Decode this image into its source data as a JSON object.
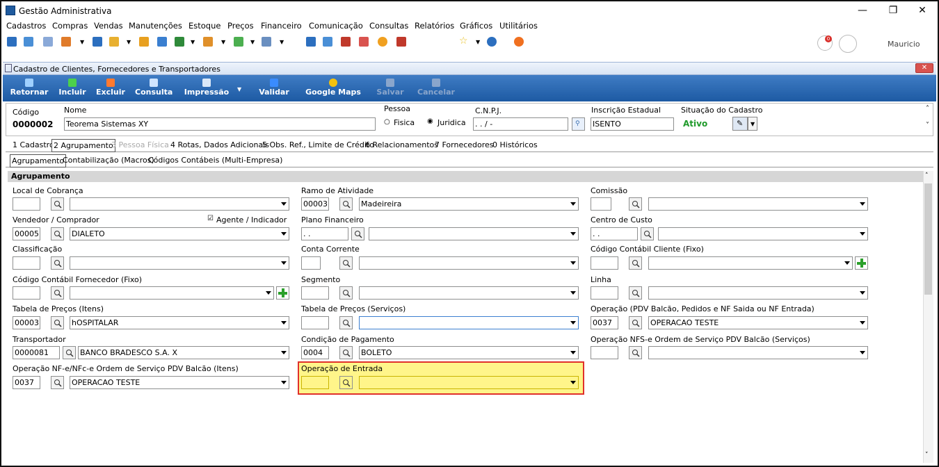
{
  "window": {
    "title": "Gestão Administrativa",
    "min": "—",
    "max": "❐",
    "close": "✕"
  },
  "menu": [
    "Cadastros",
    "Compras",
    "Vendas",
    "Manutenções",
    "Estoque",
    "Preços",
    "Financeiro",
    "Comunicação",
    "Consultas",
    "Relatórios",
    "Gráficos",
    "Utilitários"
  ],
  "user": {
    "name": "Mauricio",
    "notification_count": "0"
  },
  "child": {
    "title": "Cadastro de Clientes, Fornecedores e Transportadores",
    "close": "✕"
  },
  "actions": {
    "retornar": "Retornar",
    "incluir": "Incluir",
    "excluir": "Excluir",
    "consulta": "Consulta",
    "impressao": "Impressão",
    "validar": "Validar",
    "google_maps": "Google Maps",
    "salvar": "Salvar",
    "cancelar": "Cancelar"
  },
  "header": {
    "codigo_label": "Código",
    "codigo": "0000002",
    "nome_label": "Nome",
    "nome": "Teorema Sistemas XY",
    "pessoa_label": "Pessoa",
    "fisica": "Fisica",
    "juridica": "Juridica",
    "cnpj_label": "C.N.P.J.",
    "cnpj": "  .  .  /    -",
    "ie_label": "Inscrição Estadual",
    "ie": "ISENTO",
    "situacao_label": "Situação do Cadastro",
    "situacao": "Ativo"
  },
  "tabs": [
    "1 Cadastro",
    "2 Agrupamento",
    "3 Pessoa Física",
    "4 Rotas, Dados Adicionais",
    "5 Obs. Ref., Limite de Crédito",
    "6 Relacionamentos",
    "7 Fornecedores",
    "0 Históricos"
  ],
  "subtabs": [
    "Agrupamento",
    "Contabilização (Macros)",
    "Códigos Contábeis (Multi-Empresa)"
  ],
  "section": "Agrupamento",
  "fields": {
    "local_cobranca": {
      "label": "Local de Cobrança",
      "code": "",
      "value": ""
    },
    "ramo_atividade": {
      "label": "Ramo de Atividade",
      "code": "00003",
      "value": "Madeireira"
    },
    "comissao": {
      "label": "Comissão",
      "code": "",
      "value": ""
    },
    "vendedor": {
      "label": "Vendedor / Comprador",
      "code": "00005",
      "value": "DIALETO",
      "agente": "Agente / Indicador"
    },
    "plano_financeiro": {
      "label": "Plano Financeiro",
      "code": " .  .",
      "value": ""
    },
    "centro_custo": {
      "label": "Centro de Custo",
      "code": " .  .",
      "value": ""
    },
    "classificacao": {
      "label": "Classificação",
      "code": "",
      "value": ""
    },
    "conta_corrente": {
      "label": "Conta Corrente",
      "code": "",
      "value": ""
    },
    "cod_contabil_cliente": {
      "label": "Código Contábil Cliente (Fixo)",
      "code": "",
      "value": ""
    },
    "cod_contabil_fornecedor": {
      "label": "Código Contábil Fornecedor (Fixo)",
      "code": "",
      "value": ""
    },
    "segmento": {
      "label": "Segmento",
      "code": "",
      "value": ""
    },
    "linha": {
      "label": "Linha",
      "code": "",
      "value": ""
    },
    "tabela_precos_itens": {
      "label": "Tabela de Preços (Itens)",
      "code": "00003",
      "value": "hOSPITALAR"
    },
    "tabela_precos_servicos": {
      "label": "Tabela de Preços (Serviços)",
      "code": "",
      "value": ""
    },
    "operacao_pdv": {
      "label": "Operação (PDV Balcão, Pedidos e NF Saida ou NF Entrada)",
      "code": "0037",
      "value": "OPERACAO TESTE"
    },
    "transportador": {
      "label": "Transportador",
      "code": "0000081",
      "value": "BANCO BRADESCO S.A. X"
    },
    "condicao_pagamento": {
      "label": "Condição de Pagamento",
      "code": "0004",
      "value": "BOLETO"
    },
    "operacao_nfse": {
      "label": "Operação NFS-e Ordem de Serviço PDV Balcão (Serviços)",
      "code": "",
      "value": ""
    },
    "operacao_nfe": {
      "label": "Operação NF-e/NFc-e Ordem de Serviço PDV Balcão (Itens)",
      "code": "0037",
      "value": "OPERACAO TESTE"
    },
    "operacao_entrada": {
      "label": "Operação de Entrada",
      "code": "",
      "value": ""
    }
  }
}
